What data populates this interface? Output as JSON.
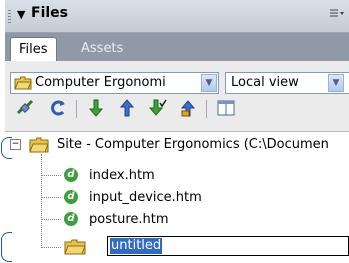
{
  "panel": {
    "title": "Files"
  },
  "tabs": [
    {
      "label": "Files"
    },
    {
      "label": "Assets"
    }
  ],
  "site_select": {
    "value": "Computer Ergonomi"
  },
  "view_select": {
    "value": "Local view"
  },
  "toolbar": {
    "buttons": [
      "connect-icon",
      "refresh-icon",
      "get-icon",
      "put-icon",
      "check-out-icon",
      "check-in-icon",
      "expand-icon"
    ]
  },
  "tree": {
    "root_label": "Site - Computer Ergonomics (C:\\Documen",
    "files": [
      "index.htm",
      "input_device.htm",
      "posture.htm"
    ],
    "new_folder": "untitled"
  },
  "colors": {
    "selection": "#316ac5",
    "folder": "#e8c24a",
    "callout": "#1e5aa8"
  }
}
